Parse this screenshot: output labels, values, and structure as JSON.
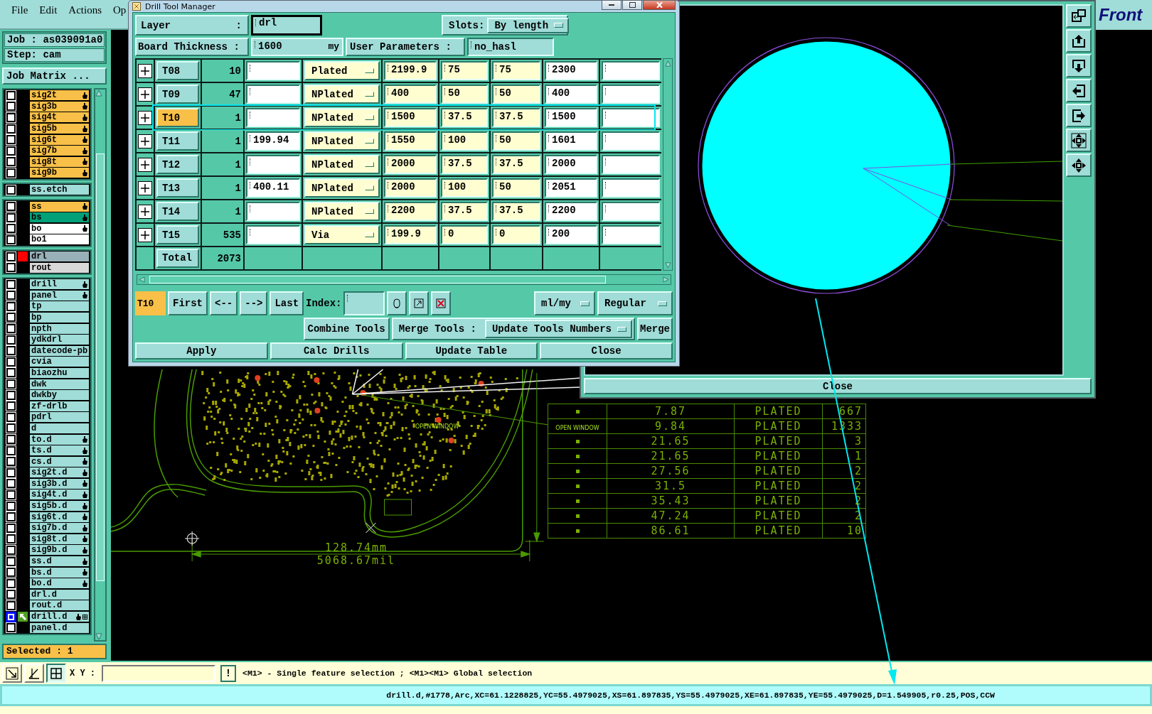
{
  "menu": [
    {
      "label": "File"
    },
    {
      "label": "Edit"
    },
    {
      "label": "Actions"
    },
    {
      "label": "Op"
    }
  ],
  "job": "Job : as039091a0",
  "step": "Step: cam",
  "job_matrix": "Job Matrix ...",
  "layer_groups": [
    {
      "layers": [
        {
          "name": "sig2t",
          "kind": "plain",
          "color": "#f8c048",
          "hand": true,
          "selected": false
        },
        {
          "name": "sig3b",
          "kind": "plain",
          "color": "#f8c048",
          "hand": true,
          "selected": false
        },
        {
          "name": "sig4t",
          "kind": "plain",
          "color": "#f8c048",
          "hand": true,
          "selected": false
        },
        {
          "name": "sig5b",
          "kind": "plain",
          "color": "#f8c048",
          "hand": true,
          "selected": false
        },
        {
          "name": "sig6t",
          "kind": "plain",
          "color": "#f8c048",
          "hand": true,
          "selected": false
        },
        {
          "name": "sig7b",
          "kind": "plain",
          "color": "#f8c048",
          "hand": true,
          "selected": false
        },
        {
          "name": "sig8t",
          "kind": "plain",
          "color": "#f8c048",
          "hand": true,
          "selected": false
        },
        {
          "name": "sig9b",
          "kind": "plain",
          "color": "#f8c048",
          "hand": true,
          "selected": false
        }
      ]
    },
    {
      "layers": [
        {
          "name": "ss.etch",
          "kind": "plain",
          "color": "#a0dcd8",
          "hand": false,
          "selected": false
        }
      ]
    },
    {
      "layers": [
        {
          "name": "ss",
          "kind": "plain",
          "color": "#f8c048",
          "hand": true,
          "selected": false
        },
        {
          "name": "bs",
          "kind": "plain",
          "color": "#00a078",
          "hand": true,
          "selected": false
        },
        {
          "name": "bo",
          "kind": "plain",
          "color": "#ffffff",
          "hand": true,
          "selected": false
        },
        {
          "name": "bo1",
          "kind": "plain",
          "color": "#ffffff",
          "hand": false,
          "selected": false
        }
      ]
    },
    {
      "layers": [
        {
          "name": "drl",
          "kind": "marked",
          "color": "#98b0b8",
          "hand": false,
          "selected": false
        },
        {
          "name": "rout",
          "kind": "plain",
          "color": "#d8d8d8",
          "hand": false,
          "selected": false
        }
      ]
    },
    {
      "layers": [
        {
          "name": "drill",
          "kind": "plain",
          "color": "#a0dcd8",
          "hand": true,
          "selected": false
        },
        {
          "name": "panel",
          "kind": "plain",
          "color": "#a0dcd8",
          "hand": true,
          "selected": false
        },
        {
          "name": "tp",
          "kind": "plain",
          "color": "#a0dcd8",
          "hand": false,
          "selected": false
        },
        {
          "name": "bp",
          "kind": "plain",
          "color": "#a0dcd8",
          "hand": false,
          "selected": false
        },
        {
          "name": "npth",
          "kind": "plain",
          "color": "#a0dcd8",
          "hand": false,
          "selected": false
        },
        {
          "name": "ydkdrl",
          "kind": "plain",
          "color": "#a0dcd8",
          "hand": false,
          "selected": false
        },
        {
          "name": "datecode-pb",
          "kind": "plain",
          "color": "#a0dcd8",
          "hand": false,
          "selected": false
        },
        {
          "name": "cvia",
          "kind": "plain",
          "color": "#a0dcd8",
          "hand": false,
          "selected": false
        },
        {
          "name": "biaozhu",
          "kind": "plain",
          "color": "#a0dcd8",
          "hand": false,
          "selected": false
        },
        {
          "name": "dwk",
          "kind": "plain",
          "color": "#a0dcd8",
          "hand": false,
          "selected": false
        },
        {
          "name": "dwkby",
          "kind": "plain",
          "color": "#a0dcd8",
          "hand": false,
          "selected": false
        },
        {
          "name": "zf-drlb",
          "kind": "plain",
          "color": "#a0dcd8",
          "hand": false,
          "selected": false
        },
        {
          "name": "pdrl",
          "kind": "plain",
          "color": "#a0dcd8",
          "hand": false,
          "selected": false
        },
        {
          "name": "d",
          "kind": "plain",
          "color": "#a0dcd8",
          "hand": false,
          "selected": false
        },
        {
          "name": "to.d",
          "kind": "plain",
          "color": "#a0dcd8",
          "hand": true,
          "selected": false
        },
        {
          "name": "ts.d",
          "kind": "plain",
          "color": "#a0dcd8",
          "hand": true,
          "selected": false
        },
        {
          "name": "cs.d",
          "kind": "plain",
          "color": "#a0dcd8",
          "hand": true,
          "selected": false
        },
        {
          "name": "sig2t.d",
          "kind": "plain",
          "color": "#a0dcd8",
          "hand": true,
          "selected": false
        },
        {
          "name": "sig3b.d",
          "kind": "plain",
          "color": "#a0dcd8",
          "hand": true,
          "selected": false
        },
        {
          "name": "sig4t.d",
          "kind": "plain",
          "color": "#a0dcd8",
          "hand": true,
          "selected": false
        },
        {
          "name": "sig5b.d",
          "kind": "plain",
          "color": "#a0dcd8",
          "hand": true,
          "selected": false
        },
        {
          "name": "sig6t.d",
          "kind": "plain",
          "color": "#a0dcd8",
          "hand": true,
          "selected": false
        },
        {
          "name": "sig7b.d",
          "kind": "plain",
          "color": "#a0dcd8",
          "hand": true,
          "selected": false
        },
        {
          "name": "sig8t.d",
          "kind": "plain",
          "color": "#a0dcd8",
          "hand": true,
          "selected": false
        },
        {
          "name": "sig9b.d",
          "kind": "plain",
          "color": "#a0dcd8",
          "hand": true,
          "selected": false
        },
        {
          "name": "ss.d",
          "kind": "plain",
          "color": "#a0dcd8",
          "hand": true,
          "selected": false
        },
        {
          "name": "bs.d",
          "kind": "plain",
          "color": "#a0dcd8",
          "hand": true,
          "selected": false
        },
        {
          "name": "bo.d",
          "kind": "plain",
          "color": "#a0dcd8",
          "hand": true,
          "selected": false
        },
        {
          "name": "drl.d",
          "kind": "plain",
          "color": "#a0dcd8",
          "hand": false,
          "selected": false
        },
        {
          "name": "rout.d",
          "kind": "plain",
          "color": "#a0dcd8",
          "hand": false,
          "selected": false
        },
        {
          "name": "drill.d",
          "kind": "work",
          "color": "#a0dcd8",
          "hand": true,
          "selected": true
        },
        {
          "name": "panel.d",
          "kind": "plain",
          "color": "#a0dcd8",
          "hand": false,
          "selected": false
        }
      ]
    }
  ],
  "selected_count": "Selected : 1",
  "dialog": {
    "title": "Drill Tool Manager",
    "layer_label": "Layer",
    "layer_colon": ":",
    "layer_value": "drl",
    "slots_label": "Slots:",
    "slots_value": "By length",
    "thickness_label": "Board Thickness :",
    "thickness_value": "1600",
    "thickness_unit": "my",
    "user_params_label": "User Parameters :",
    "user_params_value": "no_hasl",
    "rows": [
      {
        "tool": "T08",
        "count": "10",
        "type": "Plated",
        "values": [
          "2199.9",
          "75",
          "75",
          "2300"
        ],
        "selected": false
      },
      {
        "tool": "T09",
        "count": "47",
        "type": "NPlated",
        "values": [
          "400",
          "50",
          "50",
          "400"
        ],
        "selected": false
      },
      {
        "tool": "T10",
        "count": "1",
        "type": "NPlated",
        "values": [
          "1500",
          "37.5",
          "37.5",
          "1500"
        ],
        "selected": true
      },
      {
        "tool": "T11",
        "count": "1",
        "column_3": "199.94",
        "type": "NPlated",
        "values": [
          "1550",
          "100",
          "50",
          "1601"
        ],
        "selected": false
      },
      {
        "tool": "T12",
        "count": "1",
        "type": "NPlated",
        "values": [
          "2000",
          "37.5",
          "37.5",
          "2000"
        ],
        "selected": false
      },
      {
        "tool": "T13",
        "count": "1",
        "column_3": "400.11",
        "type": "NPlated",
        "values": [
          "2000",
          "100",
          "50",
          "2051"
        ],
        "selected": false
      },
      {
        "tool": "T14",
        "count": "1",
        "type": "NPlated",
        "values": [
          "2200",
          "37.5",
          "37.5",
          "2200"
        ],
        "selected": false
      },
      {
        "tool": "T15",
        "count": "535",
        "type": "Via",
        "values": [
          "199.9",
          "0",
          "0",
          "200"
        ],
        "selected": false
      }
    ],
    "total_label": "Total",
    "total_count": "2073",
    "current_tool": "T10",
    "nav_buttons": [
      "First",
      "<--",
      "-->",
      "Last"
    ],
    "index_label": "Index:",
    "units": "ml/my",
    "mode": "Regular",
    "combine": "Combine Tools",
    "merge_label": "Merge Tools :",
    "merge_option": "Update Tools Numbers",
    "merge_button": "Merge",
    "actions": [
      "Apply",
      "Calc Drills",
      "Update Table",
      "Close"
    ]
  },
  "cad": {
    "figure_table": [
      {
        "size": "7.87",
        "plating": "PLATED",
        "count": "667"
      },
      {
        "note": "OPEN WINDOW",
        "size": "9.84",
        "plating": "PLATED",
        "count": "1333"
      },
      {
        "size": "21.65",
        "plating": "PLATED",
        "count": "3"
      },
      {
        "size": "21.65",
        "plating": "PLATED",
        "count": "1"
      },
      {
        "size": "27.56",
        "plating": "PLATED",
        "count": "2"
      },
      {
        "size": "31.5",
        "plating": "PLATED",
        "count": "2"
      },
      {
        "size": "35.43",
        "plating": "PLATED",
        "count": "2"
      },
      {
        "size": "47.24",
        "plating": "PLATED",
        "count": "2"
      },
      {
        "size": "86.61",
        "plating": "PLATED",
        "count": "10"
      }
    ],
    "dimension_metric": "128.74mm",
    "dimension_imperial": "5068.67mil",
    "note": "OPEN WINDOW"
  },
  "zoom_window": {
    "close": "Close"
  },
  "logo": "Front",
  "toolbar": {
    "xy_label": "X Y :",
    "alert": "!",
    "hint": "<M1> - Single feature selection ; <M1><M1> Global selection"
  },
  "status_bar": "drill.d,#1778,Arc,XC=61.1228825,YC=55.4979025,XS=61.897835,YS=55.4979025,XE=61.897835,YE=55.4979025,D=1.549905,r0.25,POS,CCW"
}
